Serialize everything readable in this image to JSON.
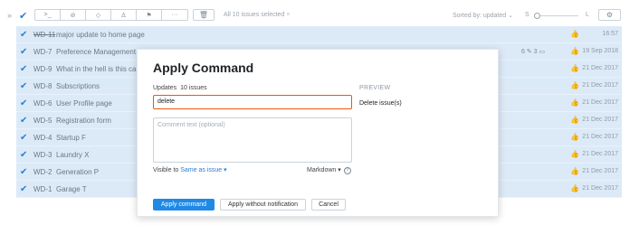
{
  "toolbar": {
    "expand_icon": "double-chevron-right",
    "select_all_icon": "checkmark",
    "tools": [
      {
        "name": "command-icon",
        "glyph": ">_"
      },
      {
        "name": "attach-icon",
        "glyph": "⊘"
      },
      {
        "name": "tag-icon",
        "glyph": "◇"
      },
      {
        "name": "assignee-icon",
        "glyph": "♙"
      },
      {
        "name": "sprint-icon",
        "glyph": "⚑"
      },
      {
        "name": "more-icon",
        "glyph": "···"
      }
    ],
    "trash_glyph": "🗑",
    "selected_text": "All 10 issues selected",
    "clear_glyph": "×",
    "sorted_text": "Sorted by: updated ⌄",
    "size_small": "S",
    "size_large": "L",
    "settings_glyph": "⚙"
  },
  "issues": [
    {
      "id": "WD-11",
      "summary": "major update to home page",
      "date": "16:57",
      "resolved": true,
      "counts": ""
    },
    {
      "id": "WD-7",
      "summary": "Preference Management",
      "date": "19 Sep 2018",
      "resolved": false,
      "counts": "6 ✎   3 ▭"
    },
    {
      "id": "WD-9",
      "summary": "What in the hell is this ca",
      "date": "21 Dec 2017",
      "resolved": false,
      "counts": ""
    },
    {
      "id": "WD-8",
      "summary": "Subscriptions",
      "date": "21 Dec 2017",
      "resolved": false,
      "counts": ""
    },
    {
      "id": "WD-6",
      "summary": "User Profile page",
      "date": "21 Dec 2017",
      "resolved": false,
      "counts": ""
    },
    {
      "id": "WD-5",
      "summary": "Registration form",
      "date": "21 Dec 2017",
      "resolved": false,
      "counts": ""
    },
    {
      "id": "WD-4",
      "summary": "Startup F",
      "date": "21 Dec 2017",
      "resolved": false,
      "counts": ""
    },
    {
      "id": "WD-3",
      "summary": "Laundry X",
      "date": "21 Dec 2017",
      "resolved": false,
      "counts": ""
    },
    {
      "id": "WD-2",
      "summary": "Generation P",
      "date": "21 Dec 2017",
      "resolved": false,
      "counts": ""
    },
    {
      "id": "WD-1",
      "summary": "Garage T",
      "date": "21 Dec 2017",
      "resolved": false,
      "counts": ""
    }
  ],
  "dialog": {
    "title": "Apply Command",
    "updates_label": "Updates",
    "updates_count": "10 issues",
    "command_value": "delete",
    "preview_label": "PREVIEW",
    "preview_text": "Delete issue(s)",
    "comment_placeholder": "Comment text (optional)",
    "visible_label": "Visible to",
    "visible_value": "Same as issue ▾",
    "markdown_label": "Markdown ▾",
    "help_glyph": "?",
    "apply_label": "Apply command",
    "apply_silent_label": "Apply without notification",
    "cancel_label": "Cancel"
  }
}
